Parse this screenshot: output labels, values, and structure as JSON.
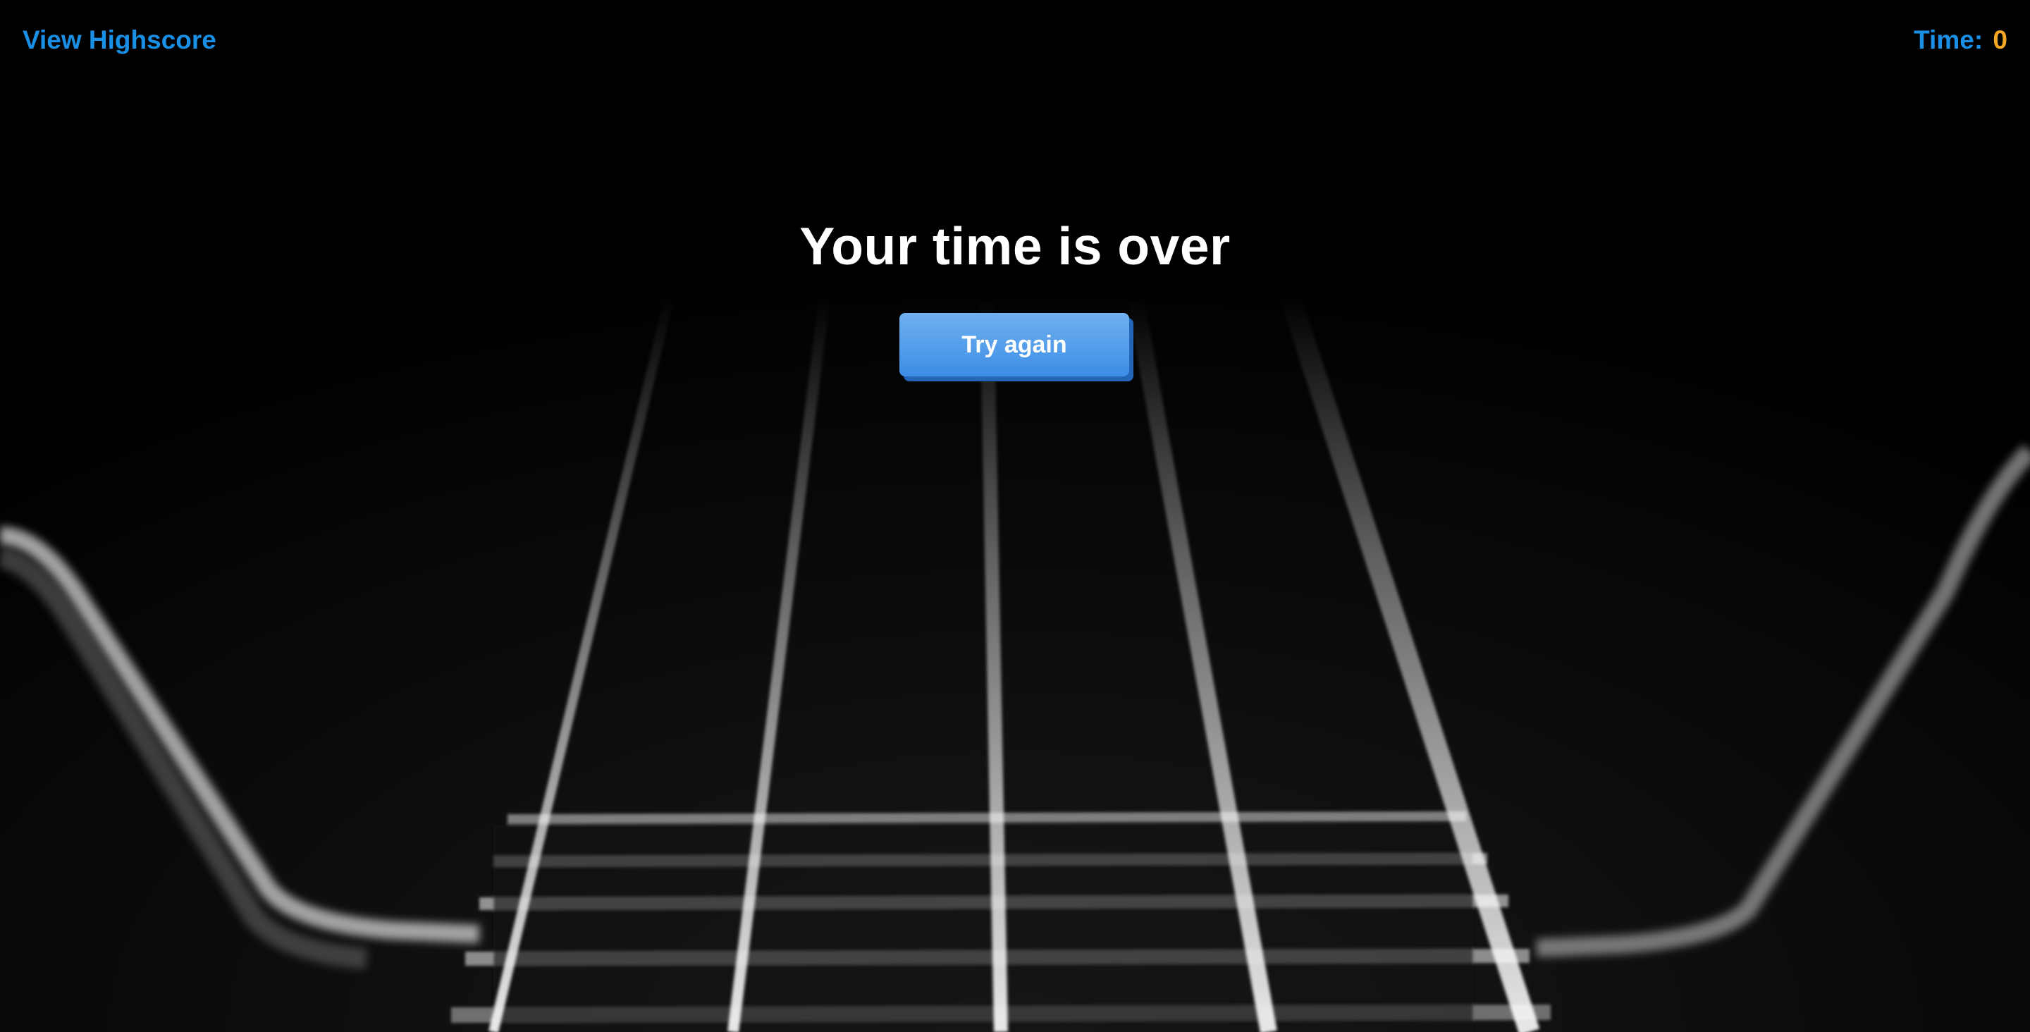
{
  "header": {
    "highscore_link": "View Highscore",
    "timer_label": "Time:",
    "timer_value": "0"
  },
  "main": {
    "title": "Your time is over",
    "retry_button": "Try again"
  },
  "colors": {
    "link": "#1a8fe6",
    "timer_value": "#f5a623",
    "button": "#4a95e8",
    "background": "#000000"
  }
}
